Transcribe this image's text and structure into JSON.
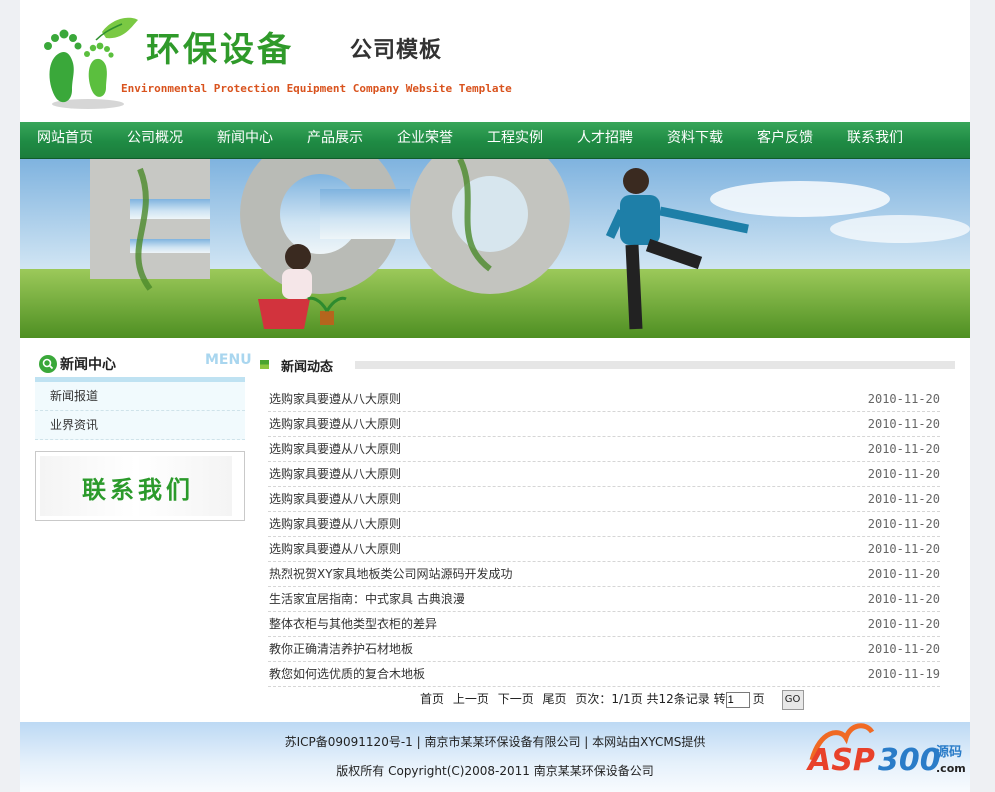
{
  "header": {
    "title": "环保设备",
    "subtitle": "公司模板",
    "english": "Environmental Protection Equipment Company Website Template"
  },
  "nav": [
    "网站首页",
    "公司概况",
    "新闻中心",
    "产品展示",
    "企业荣誉",
    "工程实例",
    "人才招聘",
    "资料下载",
    "客户反馈",
    "联系我们"
  ],
  "sidebar": {
    "title": "新闻中心",
    "menu_en": "MENU",
    "items": [
      "新闻报道",
      "业界资讯"
    ],
    "contact": "联系我们"
  },
  "main": {
    "title": "新闻动态",
    "news": [
      {
        "title": "选购家具要遵从八大原则",
        "date": "2010-11-20"
      },
      {
        "title": "选购家具要遵从八大原则",
        "date": "2010-11-20"
      },
      {
        "title": "选购家具要遵从八大原则",
        "date": "2010-11-20"
      },
      {
        "title": "选购家具要遵从八大原则",
        "date": "2010-11-20"
      },
      {
        "title": "选购家具要遵从八大原则",
        "date": "2010-11-20"
      },
      {
        "title": "选购家具要遵从八大原则",
        "date": "2010-11-20"
      },
      {
        "title": "选购家具要遵从八大原则",
        "date": "2010-11-20"
      },
      {
        "title": "热烈祝贺XY家具地板类公司网站源码开发成功",
        "date": "2010-11-20"
      },
      {
        "title": "生活家宜居指南：中式家具 古典浪漫",
        "date": "2010-11-20"
      },
      {
        "title": "整体衣柜与其他类型衣柜的差异",
        "date": "2010-11-20"
      },
      {
        "title": "教你正确清洁养护石材地板",
        "date": "2010-11-20"
      },
      {
        "title": "教您如何选优质的复合木地板",
        "date": "2010-11-19"
      }
    ],
    "pager": {
      "first": "首页",
      "prev": "上一页",
      "next": "下一页",
      "last": "尾页",
      "info": "页次：1/1页 共12条记录 转",
      "page_value": "1",
      "page_unit": "页",
      "go": "GO"
    }
  },
  "footer": {
    "line1": "苏ICP备09091120号-1 | 南京市某某环保设备有限公司 | 本网站由XYCMS提供",
    "line2": "版权所有 Copyright(C)2008-2011 南京某某环保设备公司"
  },
  "watermark": {
    "brand": "ASP300",
    "cn": "源码",
    "domain": ".com"
  },
  "colors": {
    "nav": "#1f8b44",
    "title_green": "#2f9a2a",
    "english_orange": "#d9531e",
    "footer_blue": "#bcd9f4"
  }
}
